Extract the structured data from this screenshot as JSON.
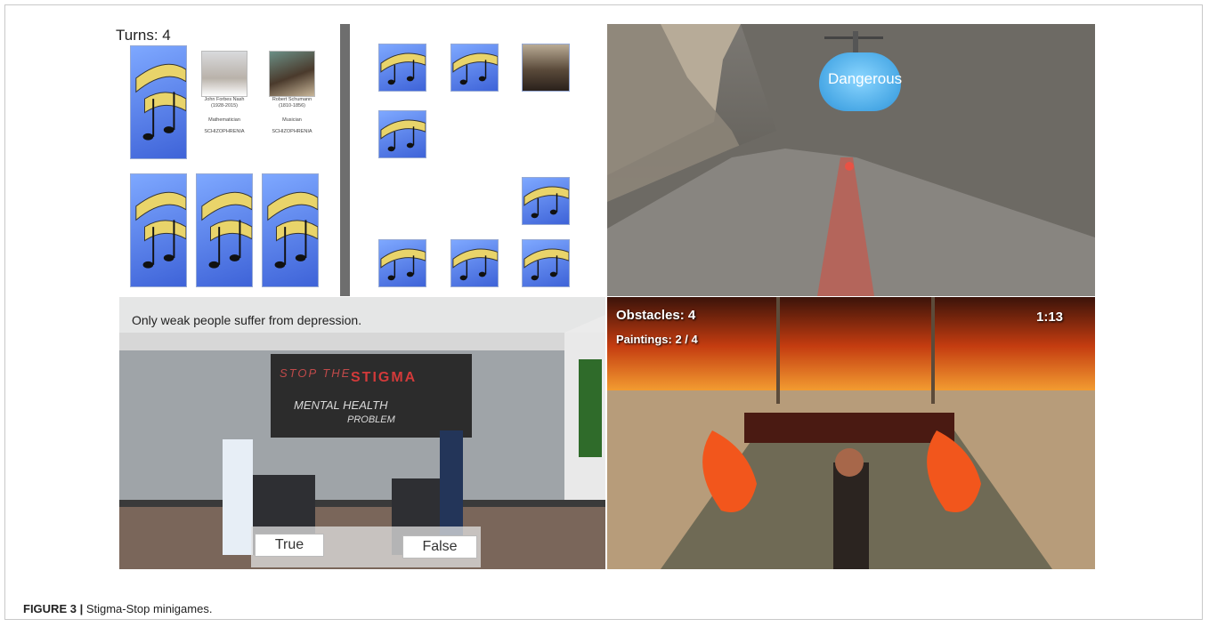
{
  "memory_game": {
    "turns_label": "Turns: 4",
    "cards": [
      {
        "type": "music",
        "name": ""
      },
      {
        "type": "portrait",
        "name": "John Forbes Nash",
        "years": "(1928-2015)",
        "profession": "Mathematician",
        "condition": "SCHIZOPHRENIA"
      },
      {
        "type": "portrait",
        "name": "Robert Schumann",
        "years": "(1810-1856)",
        "profession": "Musician",
        "condition": "SCHIZOPHRENIA"
      }
    ]
  },
  "flight_game": {
    "cloud_label": "Dangerous"
  },
  "quiz_game": {
    "statement": "Only weak people suffer from depression.",
    "board_text_1": "STOP THE",
    "board_text_2": "STIGMA",
    "board_text_3": "MENTAL HEALTH",
    "board_text_4": "PROBLEM",
    "true_label": "True",
    "false_label": "False"
  },
  "run_game": {
    "obstacles": "Obstacles: 4",
    "paintings": "Paintings: 2 / 4",
    "timer": "1:13"
  },
  "caption": {
    "label": "FIGURE 3 |",
    "text": "Stigma-Stop minigames."
  },
  "colors": {
    "card_blue": "#4f78e6",
    "sunset": "#e0651d",
    "fire": "#f2561c"
  }
}
